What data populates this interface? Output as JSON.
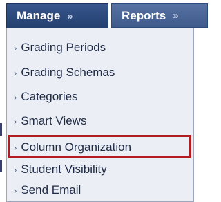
{
  "tabs": [
    {
      "label": "Manage",
      "icon": "double-chevron-down-icon"
    },
    {
      "label": "Reports",
      "icon": "double-chevron-down-icon"
    }
  ],
  "menu": {
    "items": [
      {
        "label": "Grading Periods",
        "icon": "chevron-right-icon"
      },
      {
        "label": "Grading Schemas",
        "icon": "chevron-right-icon"
      },
      {
        "label": "Categories",
        "icon": "chevron-right-icon"
      },
      {
        "label": "Smart Views",
        "icon": "chevron-right-icon"
      },
      {
        "label": "Column Organization",
        "icon": "chevron-right-icon",
        "highlighted": true
      },
      {
        "label": "Student Visibility",
        "icon": "chevron-right-icon"
      },
      {
        "label": "Send Email",
        "icon": "chevron-right-icon"
      }
    ]
  },
  "colors": {
    "tab_background": "#2b4677",
    "menu_background": "#ebeff5",
    "highlight_border": "#b01c20",
    "menu_text": "#1f2a44"
  }
}
